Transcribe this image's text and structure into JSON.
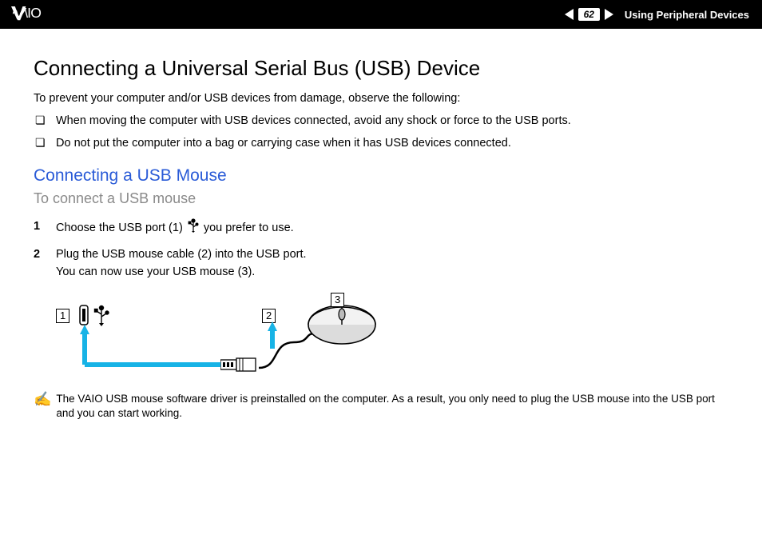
{
  "header": {
    "page_number": "62",
    "section": "Using Peripheral Devices"
  },
  "title": "Connecting a Universal Serial Bus (USB) Device",
  "intro": "To prevent your computer and/or USB devices from damage, observe the following:",
  "bullets": [
    "When moving the computer with USB devices connected, avoid any shock or force to the USB ports.",
    "Do not put the computer into a bag or carrying case when it has USB devices connected."
  ],
  "subheading": "Connecting a USB Mouse",
  "procedure_title": "To connect a USB mouse",
  "steps": [
    {
      "n": "1",
      "before": "Choose the USB port (1) ",
      "after": " you prefer to use."
    },
    {
      "n": "2",
      "before": "Plug the USB mouse cable (2) into the USB port.\nYou can now use your USB mouse (3).",
      "after": ""
    }
  ],
  "callouts": {
    "c1": "1",
    "c2": "2",
    "c3": "3"
  },
  "note": "The VAIO USB mouse software driver is preinstalled on the computer. As a result, you only need to plug the USB mouse into the USB port and you can start working."
}
